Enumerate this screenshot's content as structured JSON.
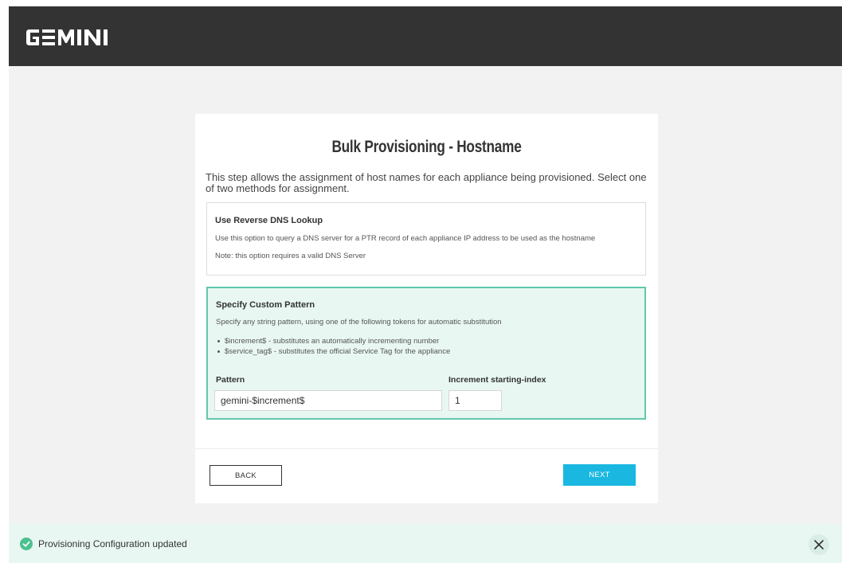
{
  "header": {
    "logo_text": "GEMINI"
  },
  "card": {
    "title": "Bulk Provisioning - Hostname",
    "description": "This step allows the assignment of host names for each appliance being provisioned. Select one of two methods for assignment.",
    "dns_option": {
      "title": "Use Reverse DNS Lookup",
      "line1": "Use this option to query a DNS server for a PTR record of each appliance IP address to be used as the hostname",
      "line2": "Note: this option requires a valid DNS Server"
    },
    "custom_option": {
      "title": "Specify Custom Pattern",
      "line1": "Specify any string pattern, using one of the following tokens for automatic substitution",
      "bullets": [
        "$increment$ - substitutes an automatically incrementing number",
        "$service_tag$ - substitutes the official Service Tag for the appliance"
      ],
      "pattern_label": "Pattern",
      "pattern_value": "gemini-$increment$",
      "index_label": "Increment starting-index",
      "index_value": "1"
    },
    "buttons": {
      "back": "BACK",
      "next": "NEXT"
    }
  },
  "toast": {
    "message": "Provisioning Configuration updated"
  },
  "colors": {
    "topbar": "#333333",
    "accent_green": "#5fc9ad",
    "accent_blue": "#1ab7e1",
    "selected_bg": "#e8f7f2"
  },
  "icons": {
    "toast_icon": "check-circle-icon",
    "close_icon": "close-icon"
  }
}
